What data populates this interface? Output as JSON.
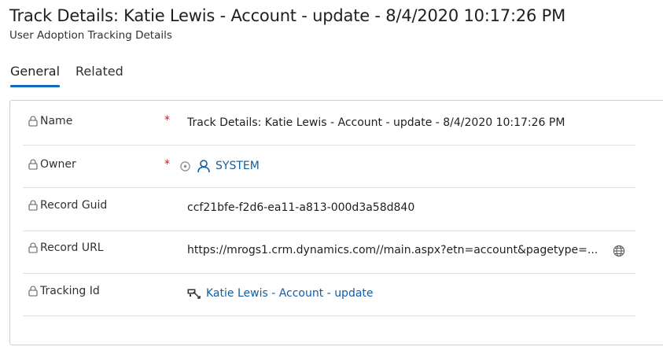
{
  "header": {
    "title": "Track Details: Katie Lewis - Account - update - 8/4/2020 10:17:26 PM",
    "subtitle": "User Adoption Tracking Details"
  },
  "tabs": [
    {
      "label": "General",
      "active": true
    },
    {
      "label": "Related",
      "active": false
    }
  ],
  "fields": {
    "name": {
      "label": "Name",
      "required": "*",
      "value": "Track Details: Katie Lewis - Account - update - 8/4/2020 10:17:26 PM"
    },
    "owner": {
      "label": "Owner",
      "required": "*",
      "value": "SYSTEM"
    },
    "guid": {
      "label": "Record Guid",
      "value": "ccf21bfe-f2d6-ea11-a813-000d3a58d840"
    },
    "url": {
      "label": "Record URL",
      "value": "https://mrogs1.crm.dynamics.com//main.aspx?etn=account&pagetype=..."
    },
    "tracking": {
      "label": "Tracking Id",
      "value": "Katie Lewis - Account - update"
    }
  },
  "colors": {
    "link": "#115ea3",
    "required": "#a4262c",
    "tab_underline": "#0f6cbd"
  }
}
